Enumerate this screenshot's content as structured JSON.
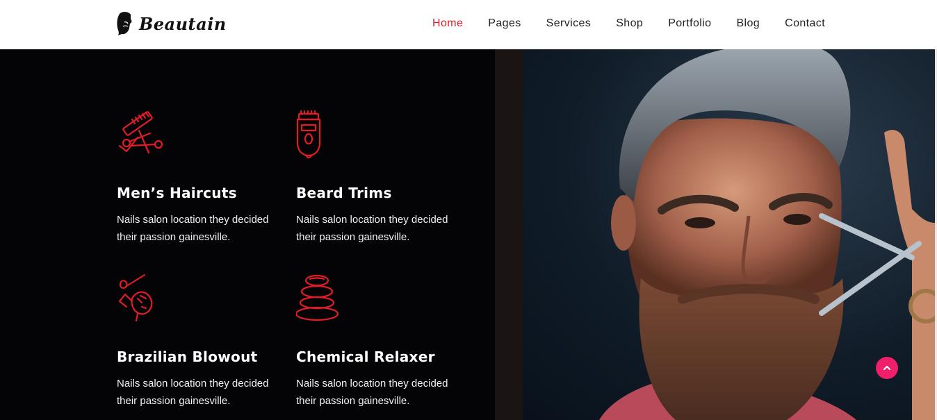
{
  "brand": {
    "name": "Beautain"
  },
  "nav": {
    "items": [
      {
        "label": "Home",
        "active": true
      },
      {
        "label": "Pages"
      },
      {
        "label": "Services"
      },
      {
        "label": "Shop"
      },
      {
        "label": "Portfolio"
      },
      {
        "label": "Blog"
      },
      {
        "label": "Contact"
      }
    ]
  },
  "services": [
    {
      "title": "Men’s Haircuts",
      "text": "Nails salon location they decided their passion gainesville.",
      "icon": "comb-scissors-icon"
    },
    {
      "title": "Beard Trims",
      "text": "Nails salon location they decided their passion gainesville.",
      "icon": "trimmer-icon"
    },
    {
      "title": "Brazilian Blowout",
      "text": "Nails salon location they decided their passion gainesville.",
      "icon": "hair-dryer-icon"
    },
    {
      "title": "Chemical Relaxer",
      "text": "Nails salon location they decided their passion gainesville.",
      "icon": "spa-stones-icon"
    }
  ],
  "colors": {
    "accent": "#e01d27",
    "dark_bg": "#040305",
    "back_to_top": "#ef1f6a"
  },
  "back_to_top": {
    "icon": "chevron-up-icon"
  },
  "hero_image": {
    "icon": "bearded-man-photo"
  }
}
